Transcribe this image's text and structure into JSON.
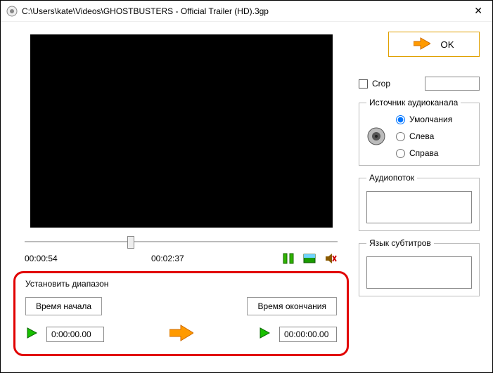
{
  "window": {
    "title": "C:\\Users\\kate\\Videos\\GHOSTBUSTERS - Official Trailer (HD).3gp"
  },
  "player": {
    "current_time": "00:00:54",
    "duration": "00:02:37",
    "progress_fraction": 0.34
  },
  "range": {
    "group_label": "Установить диапазон",
    "start_button": "Время начала",
    "end_button": "Время окончания",
    "start_value": "0:00:00.00",
    "end_value": "00:00:00.00"
  },
  "right": {
    "ok_label": "OK",
    "crop_label": "Crop",
    "crop_checked": false,
    "crop_value": "",
    "audio_src": {
      "group_label": "Источник аудиоканала",
      "options": [
        "Умолчания",
        "Слева",
        "Справа"
      ],
      "selected_index": 0
    },
    "audio_stream": {
      "group_label": "Аудиопоток"
    },
    "subtitle_lang": {
      "group_label": "Язык субтитров"
    }
  }
}
